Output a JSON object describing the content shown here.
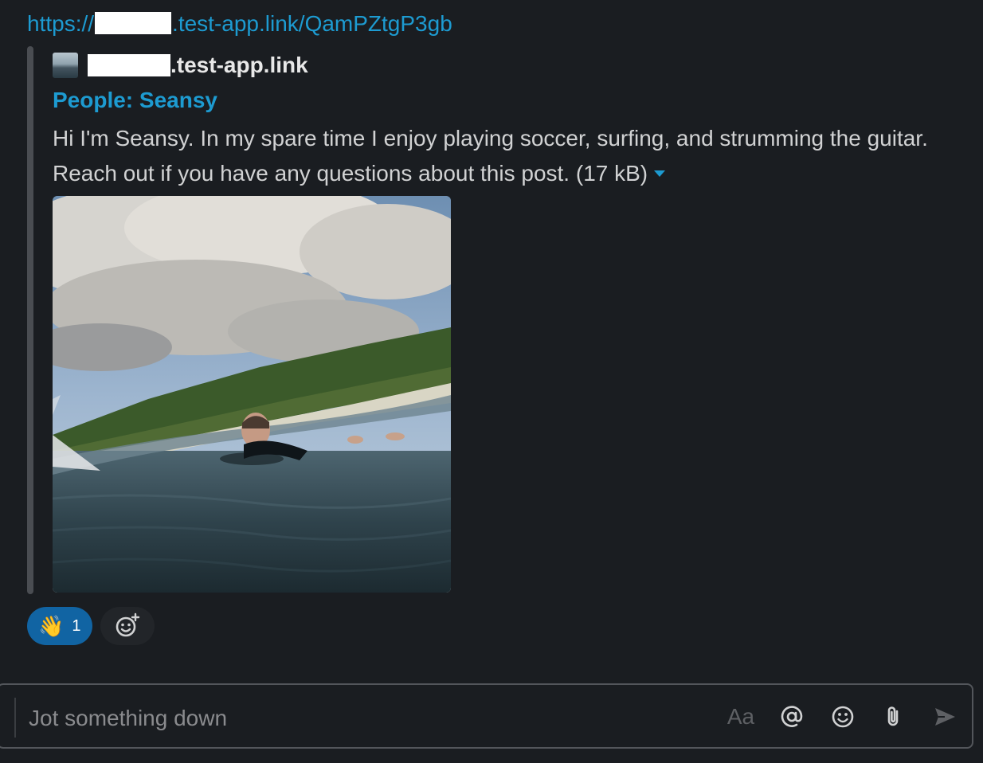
{
  "message": {
    "link_prefix": "https://",
    "link_suffix": ".test-app.link/QamPZtgP3gb"
  },
  "unfurl": {
    "site_suffix": ".test-app.link",
    "title": "People: Seansy",
    "description": "Hi I'm Seansy. In my spare time I enjoy playing soccer, surfing, and strumming the guitar. Reach out if you have any questions about this post.",
    "size": "(17 kB)",
    "image_icon": "surfer-photo"
  },
  "reactions": [
    {
      "emoji": "👋",
      "emoji_name": "waving-hand",
      "count": "1"
    }
  ],
  "add_reaction_icon": "add-reaction-icon",
  "composer": {
    "placeholder": "Jot something down",
    "format_label": "Aa",
    "icons": [
      "mention-icon",
      "emoji-icon",
      "attach-icon",
      "send-icon"
    ]
  },
  "colors": {
    "background": "#1a1d21",
    "link": "#1d9bd1",
    "reaction_active": "#1164a3"
  }
}
